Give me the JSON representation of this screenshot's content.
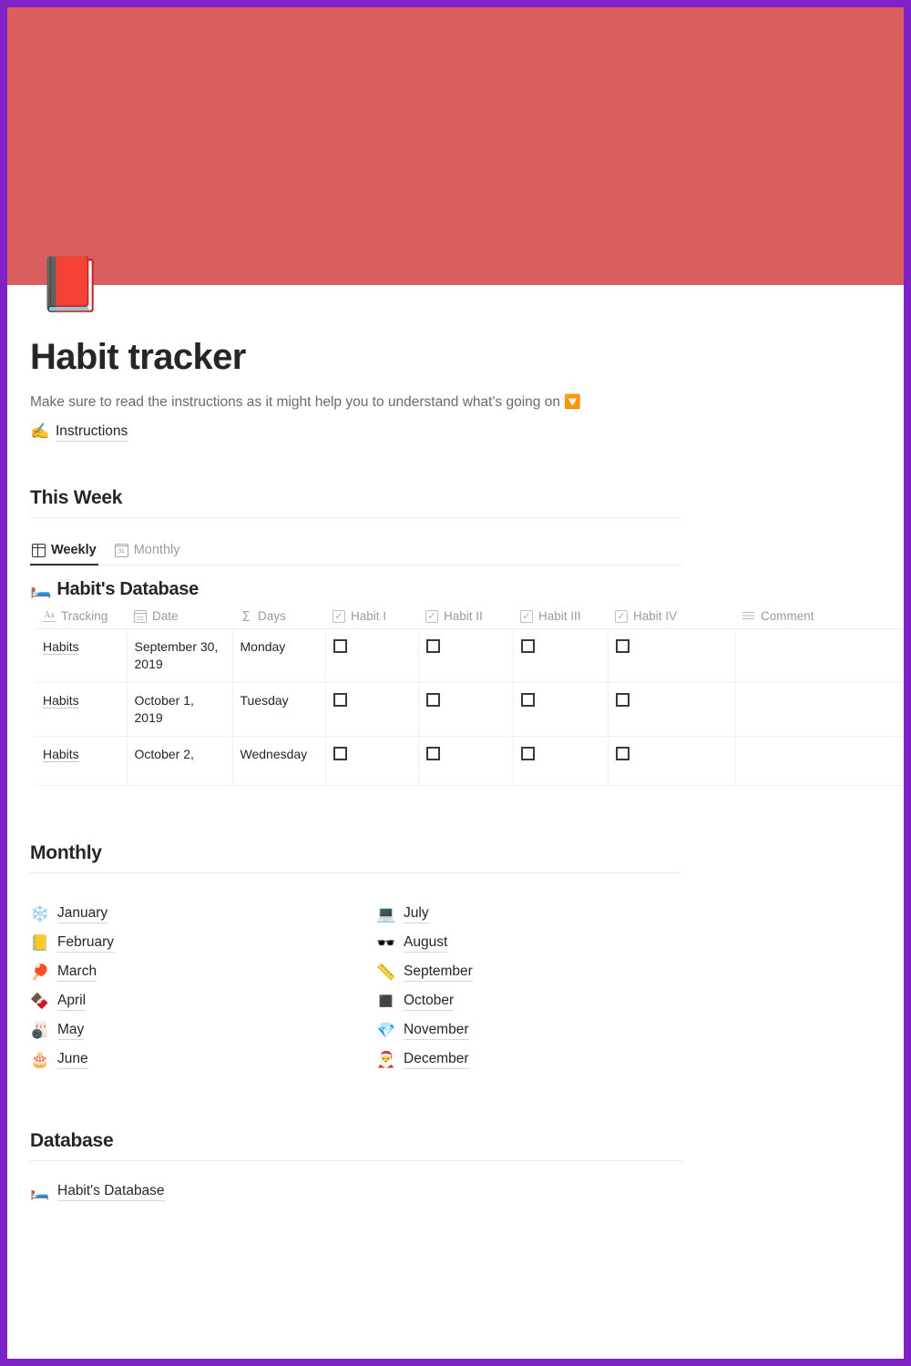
{
  "theme": {
    "frame_border_color": "#7E22C8",
    "cover_color": "#D95E5D",
    "text_color": "#262626",
    "muted_text_color": "#9B9B9B"
  },
  "cover": {
    "page_icon": "📕",
    "page_icon_name": "closed-book-emoji"
  },
  "header": {
    "title": "Habit tracker",
    "subtitle": "Make sure to read the instructions as it might help you to understand what's going on ",
    "subtitle_emoji": "🔽",
    "instructions_emoji": "✍️",
    "instructions_label": "Instructions"
  },
  "this_week": {
    "heading": "This Week",
    "tabs": [
      {
        "label": "Weekly",
        "icon": "table-icon",
        "active": true
      },
      {
        "label": "Monthly",
        "icon": "calendar-icon",
        "active": false
      }
    ],
    "database": {
      "emoji": "🛏️",
      "title": "Habit's Database",
      "columns": [
        {
          "label": "Tracking",
          "icon": "text-aa-icon"
        },
        {
          "label": "Date",
          "icon": "calendar-icon"
        },
        {
          "label": "Days",
          "icon": "sigma-icon"
        },
        {
          "label": "Habit I",
          "icon": "checkbox-icon"
        },
        {
          "label": "Habit II",
          "icon": "checkbox-icon"
        },
        {
          "label": "Habit III",
          "icon": "checkbox-icon"
        },
        {
          "label": "Habit IV",
          "icon": "checkbox-icon"
        },
        {
          "label": "Comment",
          "icon": "text-lines-icon"
        }
      ],
      "rows": [
        {
          "tracking": "Habits",
          "date": "September 30, 2019",
          "days": "Monday",
          "habit1": false,
          "habit2": false,
          "habit3": false,
          "habit4": false,
          "comment": ""
        },
        {
          "tracking": "Habits",
          "date": "October 1, 2019",
          "days": "Tuesday",
          "habit1": false,
          "habit2": false,
          "habit3": false,
          "habit4": false,
          "comment": ""
        },
        {
          "tracking": "Habits",
          "date": "October 2,",
          "days": "Wednesday",
          "habit1": false,
          "habit2": false,
          "habit3": false,
          "habit4": false,
          "comment": ""
        }
      ]
    }
  },
  "monthly": {
    "heading": "Monthly",
    "left_column": [
      {
        "emoji": "❄️",
        "label": "January",
        "icon_name": "snowflake-emoji"
      },
      {
        "emoji": "📒",
        "label": "February",
        "icon_name": "ledger-emoji"
      },
      {
        "emoji": "🏓",
        "label": "March",
        "icon_name": "ping-pong-emoji"
      },
      {
        "emoji": "🍫",
        "label": "April",
        "icon_name": "chocolate-bar-emoji"
      },
      {
        "emoji": "🎳",
        "label": "May",
        "icon_name": "bowling-emoji"
      },
      {
        "emoji": "🎂",
        "label": "June",
        "icon_name": "birthday-cake-emoji"
      }
    ],
    "right_column": [
      {
        "emoji": "💻",
        "label": "July",
        "icon_name": "laptop-emoji"
      },
      {
        "emoji": "🕶️",
        "label": "August",
        "icon_name": "sunglasses-emoji"
      },
      {
        "emoji": "📏",
        "label": "September",
        "icon_name": "ruler-emoji"
      },
      {
        "emoji": "◼️",
        "label": "October",
        "icon_name": "black-square-emoji"
      },
      {
        "emoji": "💎",
        "label": "November",
        "icon_name": "gem-emoji"
      },
      {
        "emoji": "🎅",
        "label": "December",
        "icon_name": "santa-emoji"
      }
    ]
  },
  "database_section": {
    "heading": "Database",
    "link_emoji": "🛏️",
    "link_label": "Habit's Database"
  }
}
